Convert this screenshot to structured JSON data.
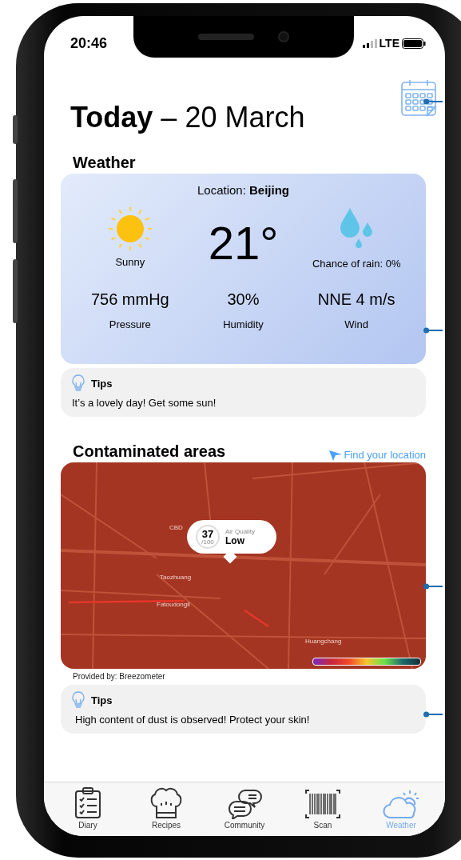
{
  "status_bar": {
    "time": "20:46",
    "network": "LTE"
  },
  "header": {
    "title": "Today",
    "date": "– 20 March"
  },
  "weather": {
    "heading": "Weather",
    "location": "Location: **Beijing**",
    "condition": "Sunny",
    "temperature": "21°",
    "rain": "Chance of rain: 0%",
    "stats": [
      {
        "value": "756 mmHg",
        "label": "Pressure"
      },
      {
        "value": "30%",
        "label": "Humidity"
      },
      {
        "value": "NNE 4 m/s",
        "label": "Wind"
      }
    ],
    "tip": {
      "title": "Tips",
      "text": "It’s a lovely day! Get some sun!"
    }
  },
  "contaminated": {
    "heading": "Contaminated areas",
    "link": "Find your location",
    "air_quality": {
      "score": "37",
      "max": "/100",
      "label": "Air Quality",
      "rating": "Low"
    },
    "map_labels": [
      "CBD",
      "Taozhuang",
      "Fatoudongli",
      "Huangchang"
    ],
    "credit": "Provided by: Breezometer",
    "tip": {
      "title": "Tips",
      "text": "High content of dust is observed! Protect your skin!"
    }
  },
  "nav": [
    {
      "kind": "diary",
      "label": "Diary",
      "selected": false
    },
    {
      "kind": "recipes",
      "label": "Recipes",
      "selected": false
    },
    {
      "kind": "community",
      "label": "Community",
      "selected": false
    },
    {
      "kind": "scan",
      "label": "Scan",
      "selected": false
    },
    {
      "kind": "weather",
      "label": "Weather",
      "selected": true
    }
  ]
}
